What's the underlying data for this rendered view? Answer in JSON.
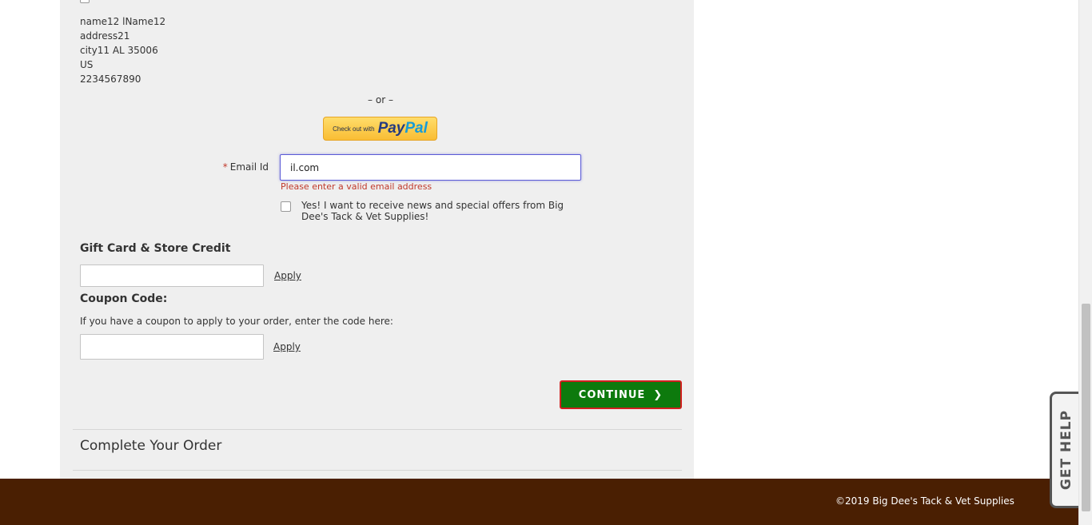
{
  "shipping_address": {
    "name": "name12 lName12",
    "street": "address21",
    "city_state_zip": "city11 AL 35006",
    "country": "US",
    "phone": "2234567890"
  },
  "divider_or": "– or –",
  "paypal": {
    "prefix": "Check out with",
    "pay": "Pay",
    "pal": "Pal"
  },
  "email": {
    "required_mark": "*",
    "label": "Email Id",
    "value": "il.com",
    "error": "Please enter a valid email address"
  },
  "newsletter": {
    "label": "Yes! I want to receive news and special offers from Big Dee's Tack & Vet Supplies!",
    "checked": false
  },
  "gift_card": {
    "title": "Gift Card & Store Credit",
    "apply_label": "Apply"
  },
  "coupon": {
    "title": "Coupon Code:",
    "help_text": "If you have a coupon to apply to your order, enter the code here:",
    "apply_label": "Apply"
  },
  "continue_label": "CONTINUE",
  "complete_title": "Complete Your Order",
  "footer": {
    "copyright": "©2019 Big Dee's Tack & Vet Supplies"
  },
  "get_help_label": "GET HELP",
  "colors": {
    "footer_bg": "#4a1f02",
    "continue_bg": "#0d7a0d",
    "continue_border": "#d11f1f",
    "error_text": "#c0392b",
    "panel_bg": "#efefef"
  }
}
